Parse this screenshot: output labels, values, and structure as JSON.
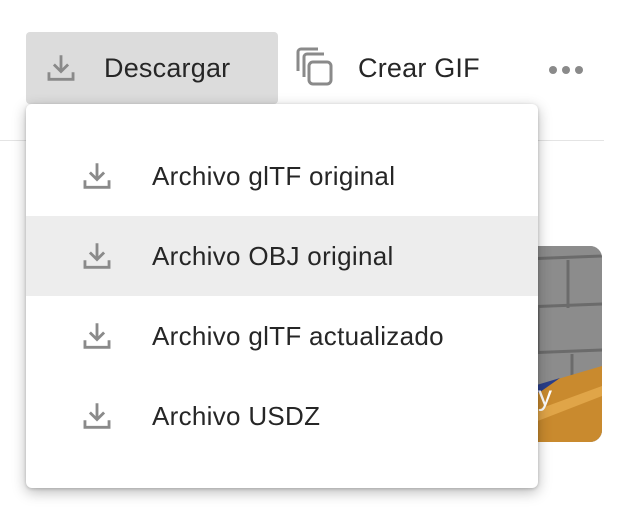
{
  "toolbar": {
    "download_label": "Descargar",
    "gif_label": "Crear GIF",
    "more_icon": "more-horizontal-icon"
  },
  "menu": {
    "items": [
      {
        "label": "Archivo glTF original",
        "icon": "download-icon",
        "highlighted": false
      },
      {
        "label": "Archivo OBJ original",
        "icon": "download-icon",
        "highlighted": true
      },
      {
        "label": "Archivo glTF actualizado",
        "icon": "download-icon",
        "highlighted": false
      },
      {
        "label": "Archivo USDZ",
        "icon": "download-icon",
        "highlighted": false
      }
    ]
  },
  "background": {
    "thumbnail_caption": "y"
  },
  "colors": {
    "button_active_bg": "#dcdcdc",
    "menu_hover_bg": "#ededed",
    "icon_gray": "#8a8a8a"
  }
}
